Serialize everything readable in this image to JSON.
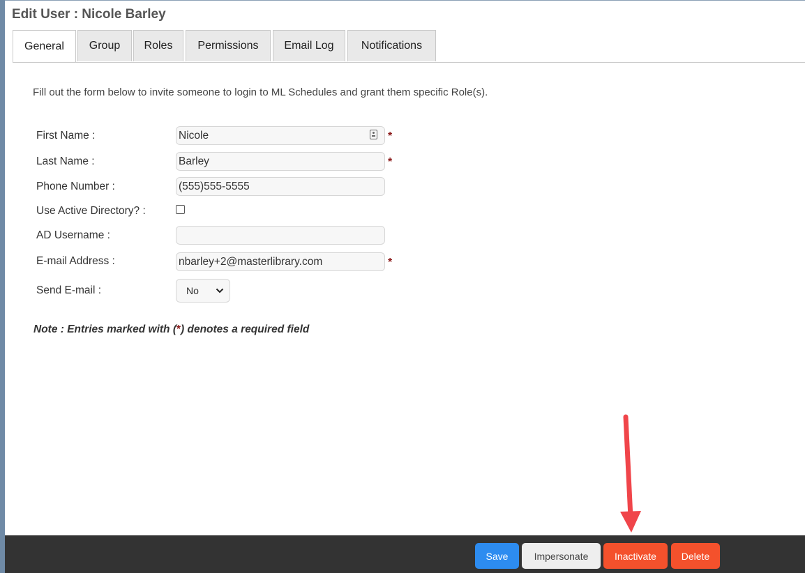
{
  "page": {
    "title": "Edit User : Nicole Barley"
  },
  "tabs": [
    {
      "label": "General",
      "active": true
    },
    {
      "label": "Group"
    },
    {
      "label": "Roles"
    },
    {
      "label": "Permissions"
    },
    {
      "label": "Email Log"
    },
    {
      "label": "Notifications"
    }
  ],
  "intro": "Fill out the form below to invite someone to login to ML Schedules and grant them specific Role(s).",
  "form": {
    "first_name": {
      "label": "First Name :",
      "value": "Nicole",
      "required": true
    },
    "last_name": {
      "label": "Last Name :",
      "value": "Barley",
      "required": true
    },
    "phone": {
      "label": "Phone Number :",
      "value": "(555)555-5555"
    },
    "use_ad": {
      "label": "Use Active Directory? :",
      "checked": false
    },
    "ad_username": {
      "label": "AD Username :",
      "value": ""
    },
    "email": {
      "label": "E-mail Address :",
      "value": "nbarley+2@masterlibrary.com",
      "required": true
    },
    "send_email": {
      "label": "Send E-mail :",
      "selected": "No"
    },
    "required_marker": "*"
  },
  "note": {
    "before": "Note : Entries marked with (",
    "star": "*",
    "after": ") denotes a required field"
  },
  "footer": {
    "save": "Save",
    "impersonate": "Impersonate",
    "inactivate": "Inactivate",
    "delete": "Delete"
  },
  "colors": {
    "primary": "#2d8cf0",
    "danger": "#f4512c",
    "required": "#8b1a1a",
    "arrow": "#f0454a",
    "footer_bg": "#333333"
  }
}
